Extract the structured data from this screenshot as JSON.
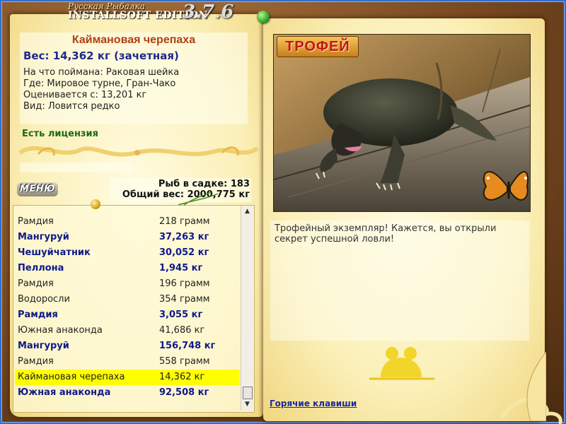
{
  "app": {
    "subtitle": "Русская Рыбалка",
    "edition": "INSTALLSOFT EDITION",
    "version": "3.7.6"
  },
  "trophy": {
    "title": "Каймановая черепаха",
    "weight_line": "Вес: 14,362 кг (зачетная)",
    "bait_line": "На что поймана: Раковая шейка",
    "place_line": "Где: Мировое турне, Гран-Чако",
    "value_line": "Оценивается с: 13,201 кг",
    "kind_line": "Вид: Ловится редко",
    "license": "Есть лицензия",
    "badge": "ТРОФЕЙ",
    "description": "Трофейный экземпляр! Кажется, вы открыли секрет успешной ловли!"
  },
  "totals": {
    "fish_count": "Рыб в садке: 183",
    "total_weight": "Общий вес: 2000,775 кг"
  },
  "menu": {
    "label": "МЕНЮ"
  },
  "catch_list": [
    {
      "name": "Рамдия",
      "weight": "218 грамм",
      "bold": false,
      "selected": false
    },
    {
      "name": "Мангуруй",
      "weight": "37,263 кг",
      "bold": true,
      "selected": false
    },
    {
      "name": "Чешуйчатник",
      "weight": "30,052 кг",
      "bold": true,
      "selected": false
    },
    {
      "name": "Пеллона",
      "weight": "1,945 кг",
      "bold": true,
      "selected": false
    },
    {
      "name": "Рамдия",
      "weight": "196 грамм",
      "bold": false,
      "selected": false
    },
    {
      "name": "Водоросли",
      "weight": "354 грамм",
      "bold": false,
      "selected": false
    },
    {
      "name": "Рамдия",
      "weight": "3,055 кг",
      "bold": true,
      "selected": false
    },
    {
      "name": "Южная анаконда",
      "weight": "41,686 кг",
      "bold": false,
      "selected": false
    },
    {
      "name": "Мангуруй",
      "weight": "156,748 кг",
      "bold": true,
      "selected": false
    },
    {
      "name": "Рамдия",
      "weight": "558 грамм",
      "bold": false,
      "selected": false
    },
    {
      "name": "Каймановая черепаха",
      "weight": "14,362 кг",
      "bold": false,
      "selected": true
    },
    {
      "name": "Южная анаконда",
      "weight": "92,508 кг",
      "bold": true,
      "selected": false
    }
  ],
  "hotkeys": {
    "label": "Горячие клавиши"
  },
  "icons": {
    "pin": "push-pin-icon",
    "scroll_up": "arrow-up-icon",
    "scroll_down": "arrow-down-icon",
    "butterfly": "butterfly-icon",
    "frog": "frog-silhouette-icon"
  }
}
